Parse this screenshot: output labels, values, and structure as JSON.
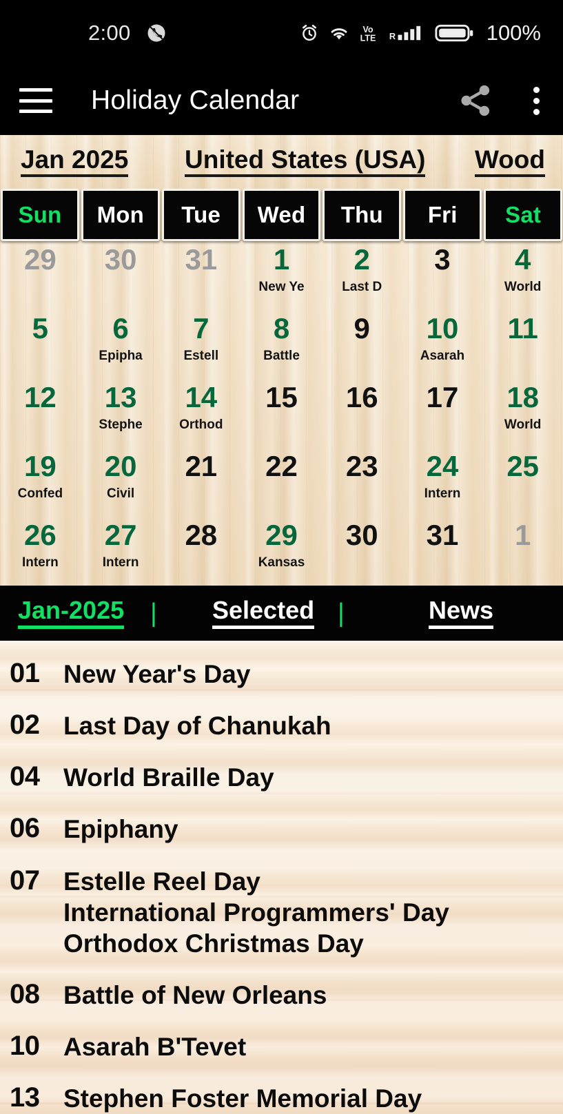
{
  "status_bar": {
    "time": "2:00",
    "battery_percent": "100%",
    "icons": [
      "missed-call-icon",
      "alarm-icon",
      "wifi-icon",
      "volte-icon",
      "signal-roaming-icon",
      "battery-icon"
    ]
  },
  "app_bar": {
    "title": "Holiday Calendar",
    "menu_icon": "hamburger-icon",
    "share_icon": "share-icon",
    "overflow_icon": "kebab-menu-icon"
  },
  "selectors": {
    "month": "Jan 2025",
    "country": "United States (USA)",
    "theme": "Wood"
  },
  "weekdays": [
    {
      "label": "Sun",
      "weekend": true
    },
    {
      "label": "Mon",
      "weekend": false
    },
    {
      "label": "Tue",
      "weekend": false
    },
    {
      "label": "Wed",
      "weekend": false
    },
    {
      "label": "Thu",
      "weekend": false
    },
    {
      "label": "Fri",
      "weekend": false
    },
    {
      "label": "Sat",
      "weekend": true
    }
  ],
  "colors": {
    "holiday_green": "#07673c",
    "accent_green": "#12e065",
    "outside_gray": "#9a9a9a",
    "normal_black": "#111111",
    "wood_grid": "#f0ddc0",
    "wood_list": "#f7e6d2",
    "bar_black": "#000000"
  },
  "calendar": {
    "weeks": [
      [
        {
          "day": "29",
          "style": "o",
          "event": ""
        },
        {
          "day": "30",
          "style": "o",
          "event": ""
        },
        {
          "day": "31",
          "style": "o",
          "event": ""
        },
        {
          "day": "1",
          "style": "g",
          "event": "New Ye"
        },
        {
          "day": "2",
          "style": "g",
          "event": "Last D"
        },
        {
          "day": "3",
          "style": "n",
          "event": ""
        },
        {
          "day": "4",
          "style": "g",
          "event": "World"
        }
      ],
      [
        {
          "day": "5",
          "style": "g",
          "event": ""
        },
        {
          "day": "6",
          "style": "g",
          "event": "Epipha"
        },
        {
          "day": "7",
          "style": "g",
          "event": "Estell"
        },
        {
          "day": "8",
          "style": "g",
          "event": "Battle"
        },
        {
          "day": "9",
          "style": "n",
          "event": ""
        },
        {
          "day": "10",
          "style": "g",
          "event": "Asarah"
        },
        {
          "day": "11",
          "style": "g",
          "event": ""
        }
      ],
      [
        {
          "day": "12",
          "style": "g",
          "event": ""
        },
        {
          "day": "13",
          "style": "g",
          "event": "Stephe"
        },
        {
          "day": "14",
          "style": "g",
          "event": "Orthod"
        },
        {
          "day": "15",
          "style": "n",
          "event": ""
        },
        {
          "day": "16",
          "style": "n",
          "event": ""
        },
        {
          "day": "17",
          "style": "n",
          "event": ""
        },
        {
          "day": "18",
          "style": "g",
          "event": "World"
        }
      ],
      [
        {
          "day": "19",
          "style": "g",
          "event": "Confed"
        },
        {
          "day": "20",
          "style": "g",
          "event": "Civil"
        },
        {
          "day": "21",
          "style": "n",
          "event": ""
        },
        {
          "day": "22",
          "style": "n",
          "event": ""
        },
        {
          "day": "23",
          "style": "n",
          "event": ""
        },
        {
          "day": "24",
          "style": "g",
          "event": "Intern"
        },
        {
          "day": "25",
          "style": "g",
          "event": ""
        }
      ],
      [
        {
          "day": "26",
          "style": "g",
          "event": "Intern"
        },
        {
          "day": "27",
          "style": "g",
          "event": "Intern"
        },
        {
          "day": "28",
          "style": "n",
          "event": ""
        },
        {
          "day": "29",
          "style": "g",
          "event": "Kansas"
        },
        {
          "day": "30",
          "style": "n",
          "event": ""
        },
        {
          "day": "31",
          "style": "n",
          "event": ""
        },
        {
          "day": "1",
          "style": "o",
          "event": ""
        }
      ]
    ]
  },
  "tabs": {
    "month_tab": "Jan-2025",
    "separator": "|",
    "selected_tab": "Selected",
    "news_tab": "News"
  },
  "holiday_list": [
    {
      "day": "01",
      "names": [
        "New Year's Day"
      ]
    },
    {
      "day": "02",
      "names": [
        "Last Day of Chanukah"
      ]
    },
    {
      "day": "04",
      "names": [
        "World Braille Day"
      ]
    },
    {
      "day": "06",
      "names": [
        "Epiphany"
      ]
    },
    {
      "day": "07",
      "names": [
        "Estelle Reel Day",
        "International Programmers' Day",
        "Orthodox Christmas Day"
      ]
    },
    {
      "day": "08",
      "names": [
        "Battle of New Orleans"
      ]
    },
    {
      "day": "10",
      "names": [
        "Asarah B'Tevet"
      ]
    },
    {
      "day": "13",
      "names": [
        "Stephen Foster Memorial Day"
      ]
    }
  ]
}
